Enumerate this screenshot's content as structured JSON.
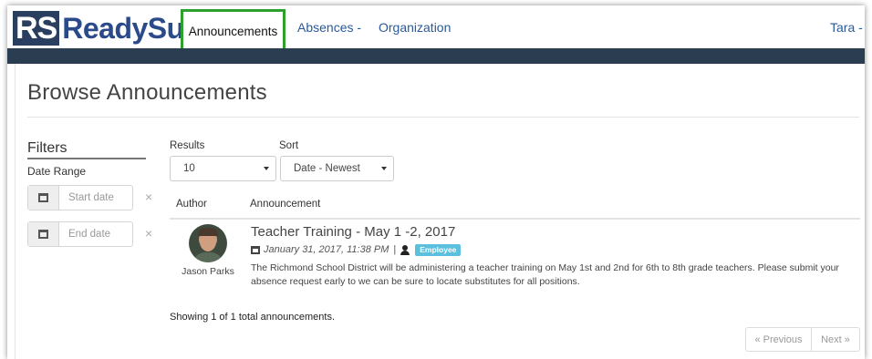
{
  "brand": {
    "initials": "RS",
    "name": "ReadySub"
  },
  "nav": {
    "active": "Announcements",
    "absences": "Absences -",
    "organization": "Organization",
    "user": "Tara -"
  },
  "page": {
    "title": "Browse Announcements"
  },
  "filters": {
    "heading": "Filters",
    "date_range_label": "Date Range",
    "start_placeholder": "Start date",
    "end_placeholder": "End date",
    "clear_glyph": "×"
  },
  "controls": {
    "results_label": "Results",
    "results_value": "10",
    "sort_label": "Sort",
    "sort_value": "Date - Newest"
  },
  "table": {
    "headers": [
      "Author",
      "Announcement"
    ],
    "rows": [
      {
        "author": "Jason Parks",
        "title": "Teacher Training - May 1 -2, 2017",
        "date": "January 31, 2017, 11:38 PM",
        "separator": "|",
        "audience": "Employee",
        "body": "The Richmond School District will be administering a teacher training on May 1st and 2nd for 6th to 8th grade teachers. Please submit your absence request early to we can be sure to locate substitutes for all positions."
      }
    ]
  },
  "summary": "Showing 1 of 1 total announcements.",
  "pagination": {
    "previous": "« Previous",
    "next": "Next »"
  },
  "colors": {
    "brand_dark": "#2a3f5f",
    "nav_link": "#2a5a9a",
    "active_outline": "#2ea02e",
    "navbar_strip": "#2b3e51",
    "badge": "#5bc0de"
  },
  "icons": [
    "calendar-icon",
    "user-icon",
    "caret-down-icon",
    "clear-icon"
  ]
}
